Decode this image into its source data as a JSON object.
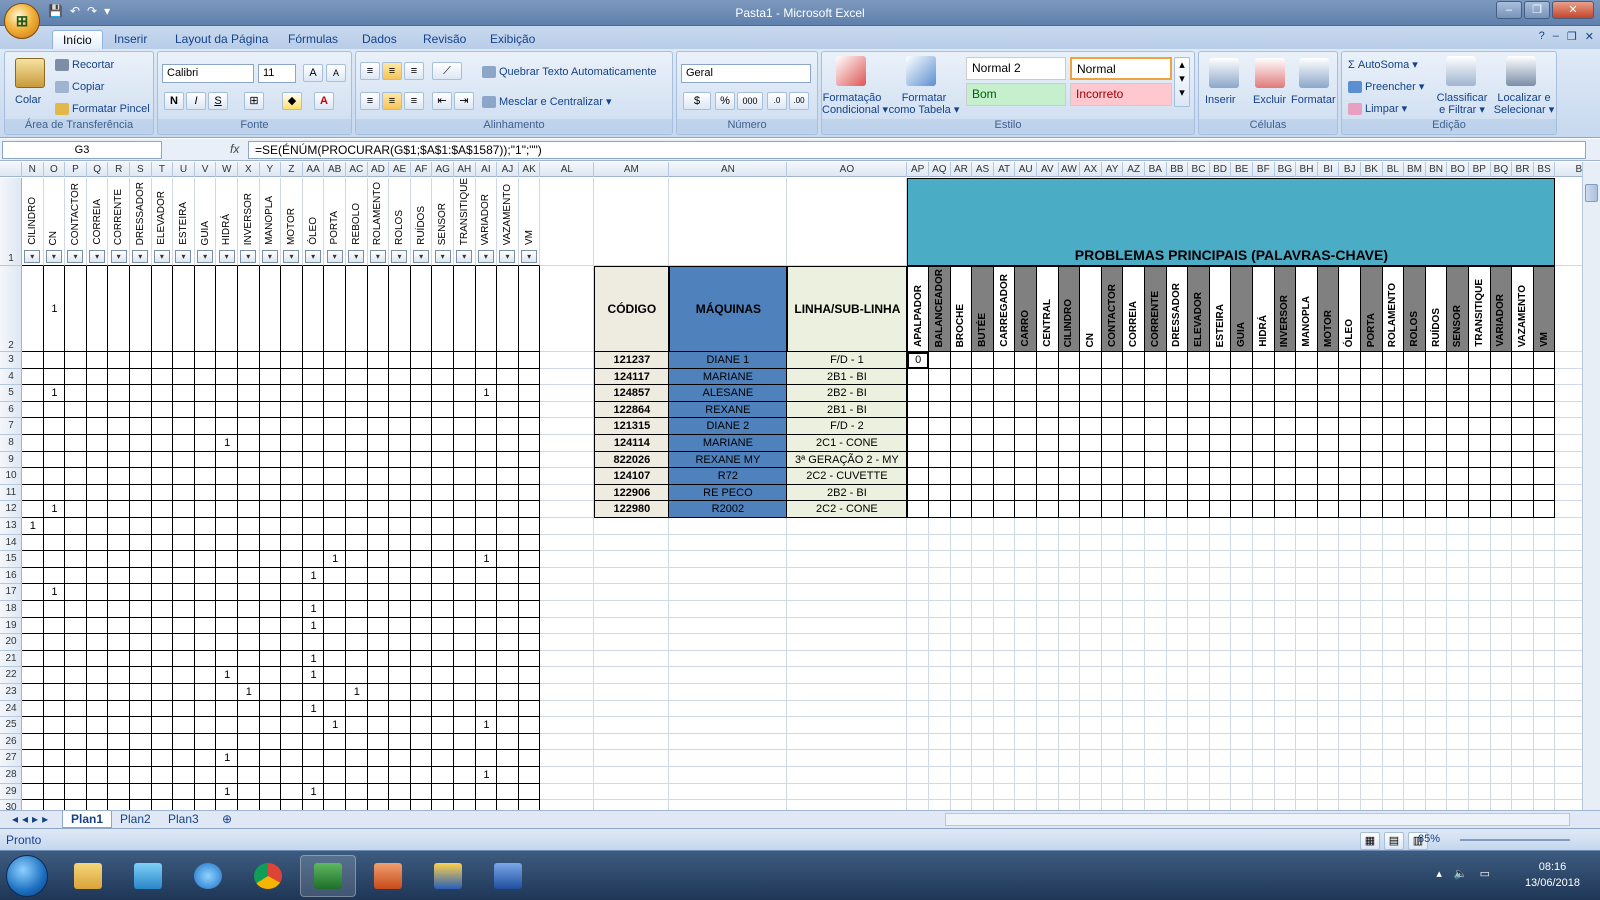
{
  "window": {
    "title": "Pasta1 - Microsoft Excel",
    "qat": [
      "💾",
      "↶",
      "↷",
      "▾"
    ],
    "controls": [
      "–",
      "❐",
      "✕"
    ]
  },
  "ribbon_tabs": [
    "Início",
    "Inserir",
    "Layout da Página",
    "Fórmulas",
    "Dados",
    "Revisão",
    "Exibição"
  ],
  "ribbon": {
    "clipboard": {
      "group": "Área de Transferência",
      "paste": "Colar",
      "cut": "Recortar",
      "copy": "Copiar",
      "painter": "Formatar Pincel"
    },
    "font": {
      "group": "Fonte",
      "name": "Calibri",
      "size": "11",
      "bold": "N",
      "italic": "I",
      "underline": "S"
    },
    "alignment": {
      "group": "Alinhamento",
      "wrap": "Quebrar Texto Automaticamente",
      "merge": "Mesclar e Centralizar"
    },
    "number": {
      "group": "Número",
      "format": "Geral",
      "percent": "%",
      "thousands": "000"
    },
    "styles": {
      "group": "Estilo",
      "cond_l1": "Formatação",
      "cond_l2": "Condicional",
      "table_l1": "Formatar",
      "table_l2": "como Tabela",
      "normal2": "Normal 2",
      "normal": "Normal",
      "bom": "Bom",
      "incorreto": "Incorreto"
    },
    "cells": {
      "group": "Células",
      "insert": "Inserir",
      "delete": "Excluir",
      "format": "Formatar"
    },
    "editing": {
      "group": "Edição",
      "autosum": "AutoSoma",
      "fill": "Preencher",
      "clear": "Limpar",
      "sort_l1": "Classificar",
      "sort_l2": "e Filtrar",
      "find_l1": "Localizar e",
      "find_l2": "Selecionar"
    }
  },
  "formula_bar": {
    "name_box": "G3",
    "fx": "fx",
    "formula": "=SE(ÉNÚM(PROCURAR(G$1;$A$1:$A$1587));\"1\";\"\")"
  },
  "left_columns": [
    "N",
    "O",
    "P",
    "Q",
    "R",
    "S",
    "T",
    "U",
    "V",
    "W",
    "X",
    "Y",
    "Z",
    "AA",
    "AB",
    "AC",
    "AD",
    "AE",
    "AF",
    "AG",
    "AH",
    "AI",
    "AJ",
    "AK"
  ],
  "left_headers": [
    "CILINDRO",
    "CN",
    "CONTACTOR",
    "CORREIA",
    "CORRENTE",
    "DRESSADOR",
    "ELEVADOR",
    "ESTEIRA",
    "GUIA",
    "HIDRÁ",
    "INVERSOR",
    "MANOPLA",
    "MOTOR",
    "ÓLEO",
    "PORTA",
    "REBOLO",
    "ROLAMENTO",
    "ROLOS",
    "RUÍDOS",
    "SENSOR",
    "TRANSITIQUE",
    "VARIADOR",
    "VAZAMENTO",
    "VM"
  ],
  "left_ones": [
    [
      2,
      1
    ],
    [
      5,
      1
    ],
    [
      5,
      21
    ],
    [
      8,
      9
    ],
    [
      12,
      1
    ],
    [
      13,
      0
    ],
    [
      15,
      14
    ],
    [
      15,
      21
    ],
    [
      16,
      13
    ],
    [
      17,
      1
    ],
    [
      18,
      13
    ],
    [
      19,
      13
    ],
    [
      21,
      13
    ],
    [
      22,
      9
    ],
    [
      22,
      13
    ],
    [
      23,
      10
    ],
    [
      23,
      15
    ],
    [
      24,
      13
    ],
    [
      25,
      14
    ],
    [
      25,
      21
    ],
    [
      27,
      9
    ],
    [
      28,
      21
    ],
    [
      29,
      9
    ],
    [
      29,
      13
    ]
  ],
  "mid_columns": [
    "AL",
    "AM",
    "AN",
    "AO"
  ],
  "right_columns": [
    "AP",
    "AQ",
    "AR",
    "AS",
    "AT",
    "AU",
    "AV",
    "AW",
    "AX",
    "AY",
    "AZ",
    "BA",
    "BB",
    "BC",
    "BD",
    "BE",
    "BF",
    "BG",
    "BH",
    "BI",
    "BJ",
    "BK",
    "BL",
    "BM",
    "BN",
    "BO",
    "BP",
    "BQ",
    "BR",
    "BS",
    "BT"
  ],
  "table": {
    "banner": "PROBLEMAS PRINCIPAIS (PALAVRAS-CHAVE)",
    "h_codigo": "CÓDIGO",
    "h_maquinas": "MÁQUINAS",
    "h_linha": "LINHA/SUB-LINHA",
    "keywords": [
      "APALPADOR",
      "BALANCEADOR",
      "BROCHE",
      "BUTÉE",
      "CARREGADOR",
      "CARRO",
      "CENTRAL",
      "CILINDRO",
      "CN",
      "CONTACTOR",
      "CORREIA",
      "CORRENTE",
      "DRESSADOR",
      "ELEVADOR",
      "ESTEIRA",
      "GUIA",
      "HIDRÁ",
      "INVERSOR",
      "MANOPLA",
      "MOTOR",
      "ÓLEO",
      "PORTA",
      "ROLAMENTO",
      "ROLOS",
      "RUÍDOS",
      "SENSOR",
      "TRANSITIQUE",
      "VARIADOR",
      "VAZAMENTO",
      "VM"
    ],
    "first_value": "0",
    "rows": [
      {
        "codigo": "121237",
        "maquina": "DIANE 1",
        "linha": "F/D - 1"
      },
      {
        "codigo": "124117",
        "maquina": "MARIANE",
        "linha": "2B1 - BI"
      },
      {
        "codigo": "124857",
        "maquina": "ALESANE",
        "linha": "2B2 - BI"
      },
      {
        "codigo": "122864",
        "maquina": "REXANE",
        "linha": "2B1 - BI"
      },
      {
        "codigo": "121315",
        "maquina": "DIANE 2",
        "linha": "F/D - 2"
      },
      {
        "codigo": "124114",
        "maquina": "MARIANE",
        "linha": "2C1 - CONE"
      },
      {
        "codigo": "822026",
        "maquina": "REXANE MY",
        "linha": "3ª GERAÇÃO 2 - MY"
      },
      {
        "codigo": "124107",
        "maquina": "R72",
        "linha": "2C2 - CUVETTE"
      },
      {
        "codigo": "122906",
        "maquina": "RE PECO",
        "linha": "2B2 - BI"
      },
      {
        "codigo": "122980",
        "maquina": "R2002",
        "linha": "2C2 - CONE"
      }
    ]
  },
  "sheet_tabs": [
    "Plan1",
    "Plan2",
    "Plan3"
  ],
  "status": {
    "ready": "Pronto",
    "zoom": "85%"
  },
  "taskbar": {
    "time": "08:16",
    "date": "13/06/2018"
  },
  "colors": {
    "banner": "#4bacc6",
    "maquinas": "#4f81bd",
    "linha": "#ebf1de",
    "codigo": "#eeece1",
    "keyword_dark": "#808080"
  }
}
